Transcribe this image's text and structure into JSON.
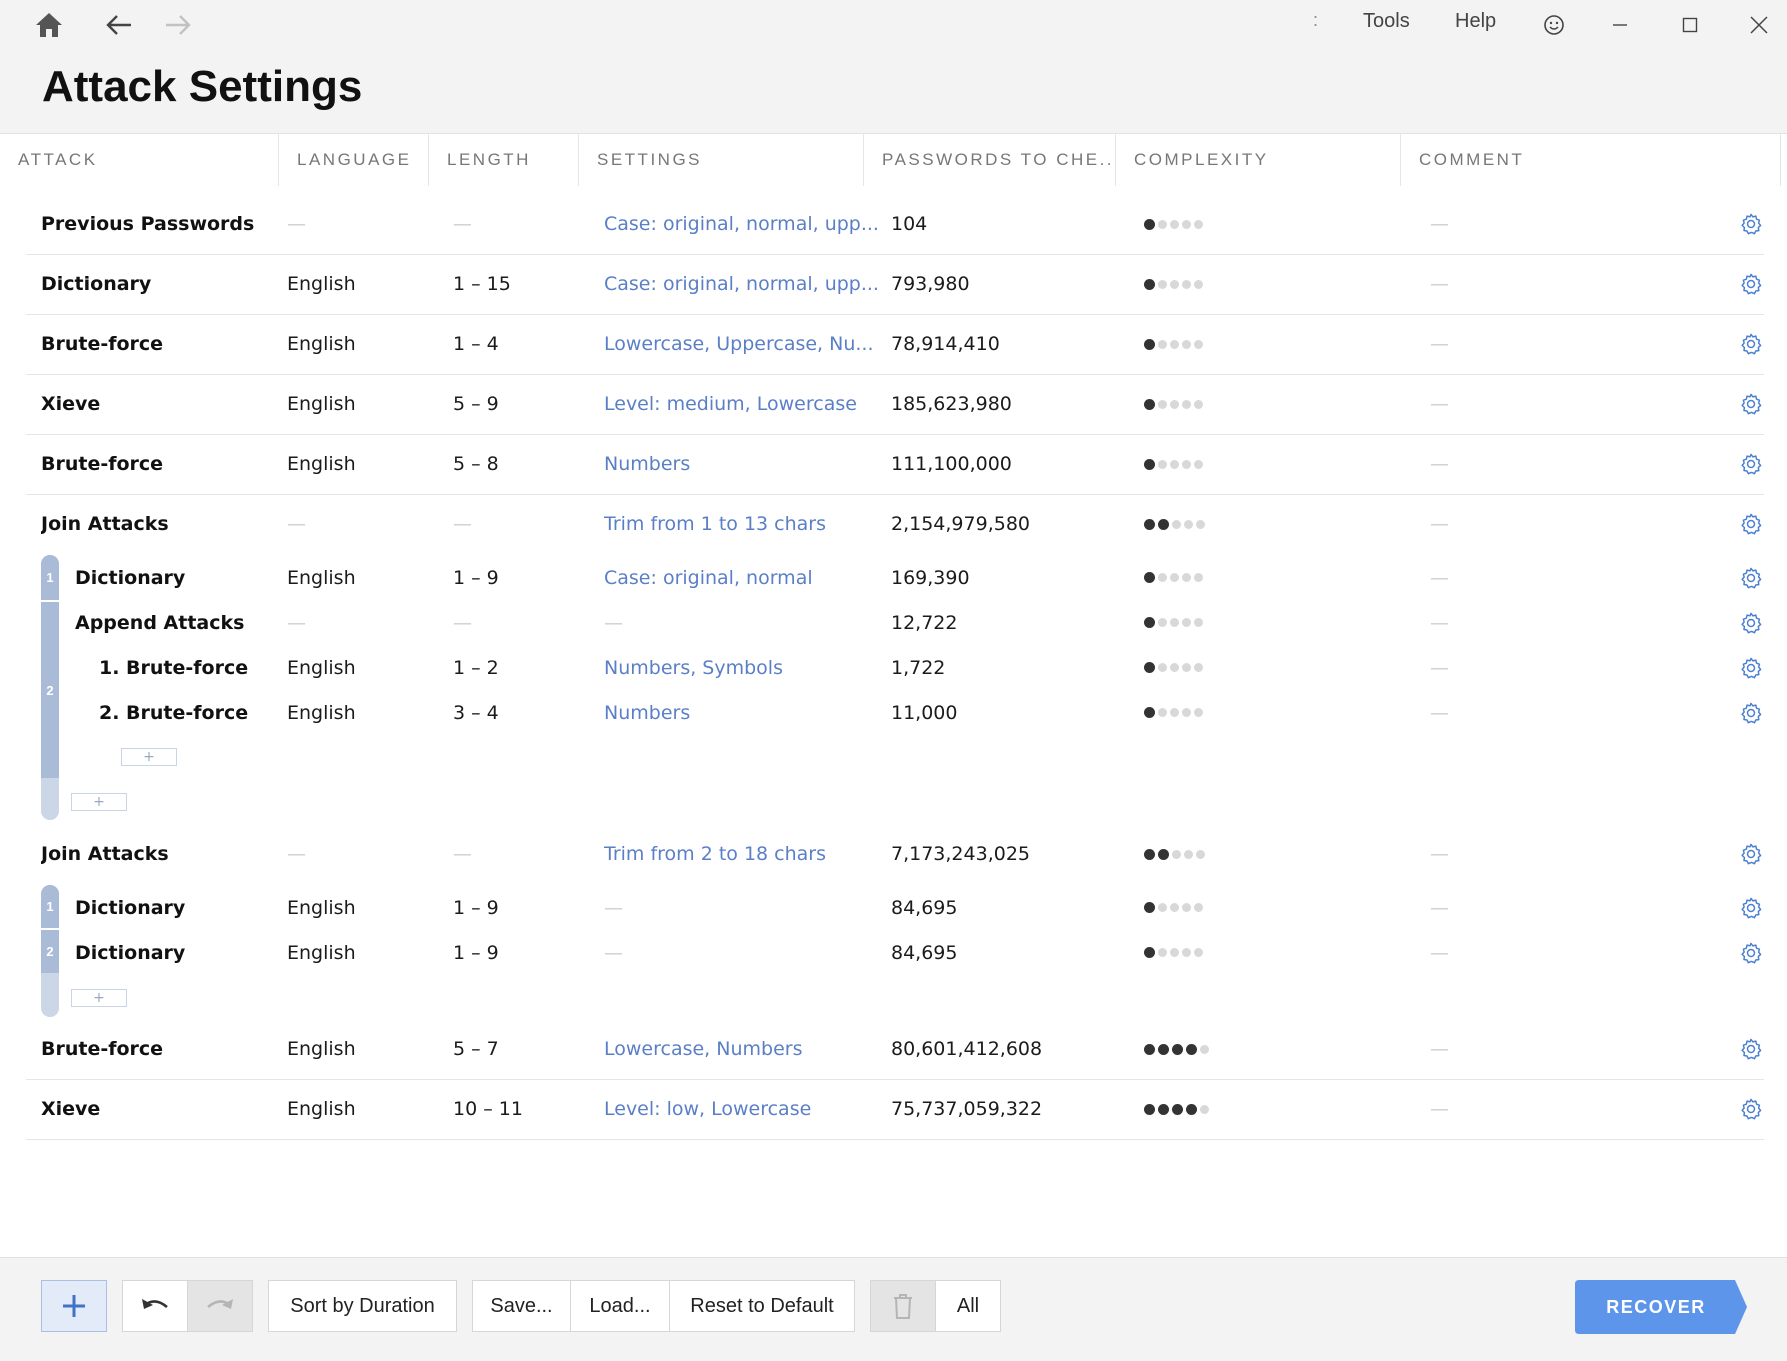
{
  "titlebar": {
    "menu_separator": ":",
    "menu": [
      "Tools",
      "Help"
    ]
  },
  "page_title": "Attack Settings",
  "columns": [
    "ATTACK",
    "LANGUAGE",
    "LENGTH",
    "SETTINGS",
    "PASSWORDS TO CHE...",
    "COMPLEXITY",
    "COMMENT"
  ],
  "empty_value": "—",
  "rows": [
    {
      "name": "Previous Passwords",
      "language": "—",
      "length": "—",
      "settings": "Case: original, normal, upp...",
      "passwords": "104",
      "complexity": 1,
      "comment": "—"
    },
    {
      "name": "Dictionary",
      "language": "English",
      "length": "1 – 15",
      "settings": "Case: original, normal, upp...",
      "passwords": "793,980",
      "complexity": 1,
      "comment": "—"
    },
    {
      "name": "Brute-force",
      "language": "English",
      "length": "1 – 4",
      "settings": "Lowercase, Uppercase, Nu...",
      "passwords": "78,914,410",
      "complexity": 1,
      "comment": "—"
    },
    {
      "name": "Xieve",
      "language": "English",
      "length": "5 – 9",
      "settings": "Level: medium, Lowercase",
      "passwords": "185,623,980",
      "complexity": 1,
      "comment": "—"
    },
    {
      "name": "Brute-force",
      "language": "English",
      "length": "5 – 8",
      "settings": "Numbers",
      "passwords": "111,100,000",
      "complexity": 1,
      "comment": "—"
    },
    {
      "name": "Join Attacks",
      "language": "—",
      "length": "—",
      "settings": "Trim from 1 to 13 chars",
      "passwords": "2,154,979,580",
      "complexity": 2,
      "comment": "—"
    },
    {
      "name": "Dictionary",
      "language": "English",
      "length": "1 – 9",
      "settings": "Case: original, normal",
      "passwords": "169,390",
      "complexity": 1,
      "comment": "—"
    },
    {
      "name": "Append Attacks",
      "language": "—",
      "length": "—",
      "settings": "—",
      "passwords": "12,722",
      "complexity": 1,
      "comment": "—"
    },
    {
      "name": "1. Brute-force",
      "language": "English",
      "length": "1 – 2",
      "settings": "Numbers, Symbols",
      "passwords": "1,722",
      "complexity": 1,
      "comment": "—"
    },
    {
      "name": "2. Brute-force",
      "language": "English",
      "length": "3 – 4",
      "settings": "Numbers",
      "passwords": "11,000",
      "complexity": 1,
      "comment": "—"
    },
    {
      "name": "Join Attacks",
      "language": "—",
      "length": "—",
      "settings": "Trim from 2 to 18 chars",
      "passwords": "7,173,243,025",
      "complexity": 2,
      "comment": "—"
    },
    {
      "name": "Dictionary",
      "language": "English",
      "length": "1 – 9",
      "settings": "—",
      "passwords": "84,695",
      "complexity": 1,
      "comment": "—"
    },
    {
      "name": "Dictionary",
      "language": "English",
      "length": "1 – 9",
      "settings": "—",
      "passwords": "84,695",
      "complexity": 1,
      "comment": "—"
    },
    {
      "name": "Brute-force",
      "language": "English",
      "length": "5 – 7",
      "settings": "Lowercase, Numbers",
      "passwords": "80,601,412,608",
      "complexity": 4,
      "comment": "—"
    },
    {
      "name": "Xieve",
      "language": "English",
      "length": "10 – 11",
      "settings": "Level: low, Lowercase",
      "passwords": "75,737,059,322",
      "complexity": 4,
      "comment": "—"
    }
  ],
  "complexity_max": 5,
  "join_groups": [
    {
      "segments": [
        "1",
        "2"
      ],
      "add_label": "+",
      "nested_add_label": "+"
    },
    {
      "segments": [
        "1",
        "2"
      ],
      "add_label": "+"
    }
  ],
  "toolbar": {
    "sort_label": "Sort by Duration",
    "save_label": "Save...",
    "load_label": "Load...",
    "reset_label": "Reset to Default",
    "all_label": "All",
    "recover_label": "RECOVER"
  },
  "colors": {
    "accent": "#5b7fc7",
    "recover": "#5c95ea",
    "gear": "#4a7fd0",
    "group_bar": "#a9bbd6"
  }
}
